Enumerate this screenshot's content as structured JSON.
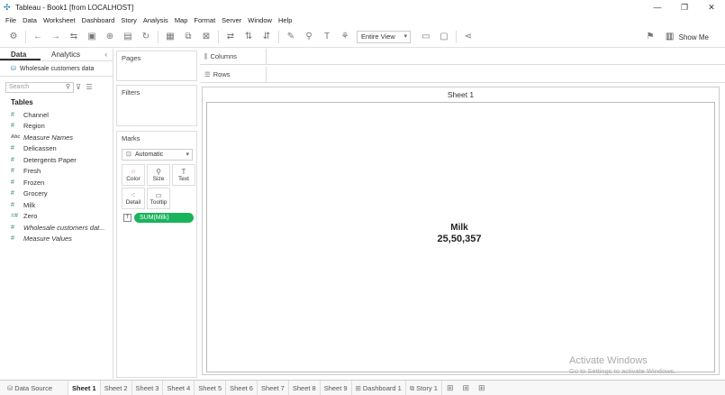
{
  "window": {
    "title": "Tableau - Book1 [from LOCALHOST]",
    "controls": [
      "—",
      "❐",
      "✕"
    ]
  },
  "menu": [
    "File",
    "Data",
    "Worksheet",
    "Dashboard",
    "Story",
    "Analysis",
    "Map",
    "Format",
    "Server",
    "Window",
    "Help"
  ],
  "toolbar": {
    "fit_select": "Entire View",
    "show_me": "Show Me"
  },
  "data_pane": {
    "tabs": [
      "Data",
      "Analytics"
    ],
    "datasource": "Wholesale customers data",
    "search_placeholder": "Search",
    "tables_header": "Tables",
    "fields": [
      {
        "name": "Channel",
        "icon": "#"
      },
      {
        "name": "Region",
        "icon": "#"
      },
      {
        "name": "Measure Names",
        "icon": "Abc"
      },
      {
        "name": "Delicassen",
        "icon": "#"
      },
      {
        "name": "Detergents Paper",
        "icon": "#"
      },
      {
        "name": "Fresh",
        "icon": "#"
      },
      {
        "name": "Frozen",
        "icon": "#"
      },
      {
        "name": "Grocery",
        "icon": "#"
      },
      {
        "name": "Milk",
        "icon": "#"
      },
      {
        "name": "Zero",
        "icon": "=#"
      },
      {
        "name": "Wholesale customers dat...",
        "icon": "#"
      },
      {
        "name": "Measure Values",
        "icon": "#"
      }
    ]
  },
  "cards": {
    "pages": "Pages",
    "filters": "Filters",
    "marks": "Marks",
    "mark_type": "Automatic",
    "mark_buttons": [
      "Color",
      "Size",
      "Text",
      "Detail",
      "Tooltip"
    ],
    "pill": "SUM(Milk)"
  },
  "shelves": {
    "columns": "Columns",
    "rows": "Rows"
  },
  "view": {
    "sheet_title": "Sheet 1",
    "kpi_label": "Milk",
    "kpi_value": "25,50,357"
  },
  "watermark": {
    "line1": "Activate Windows",
    "line2": "Go to Settings to activate Windows."
  },
  "bottom_tabs": {
    "data_source": "Data Source",
    "sheets": [
      "Sheet 1",
      "Sheet 2",
      "Sheet 3",
      "Sheet 4",
      "Sheet 5",
      "Sheet 6",
      "Sheet 7",
      "Sheet 8",
      "Sheet 9"
    ],
    "dashboard": "Dashboard 1",
    "story": "Story 1"
  }
}
